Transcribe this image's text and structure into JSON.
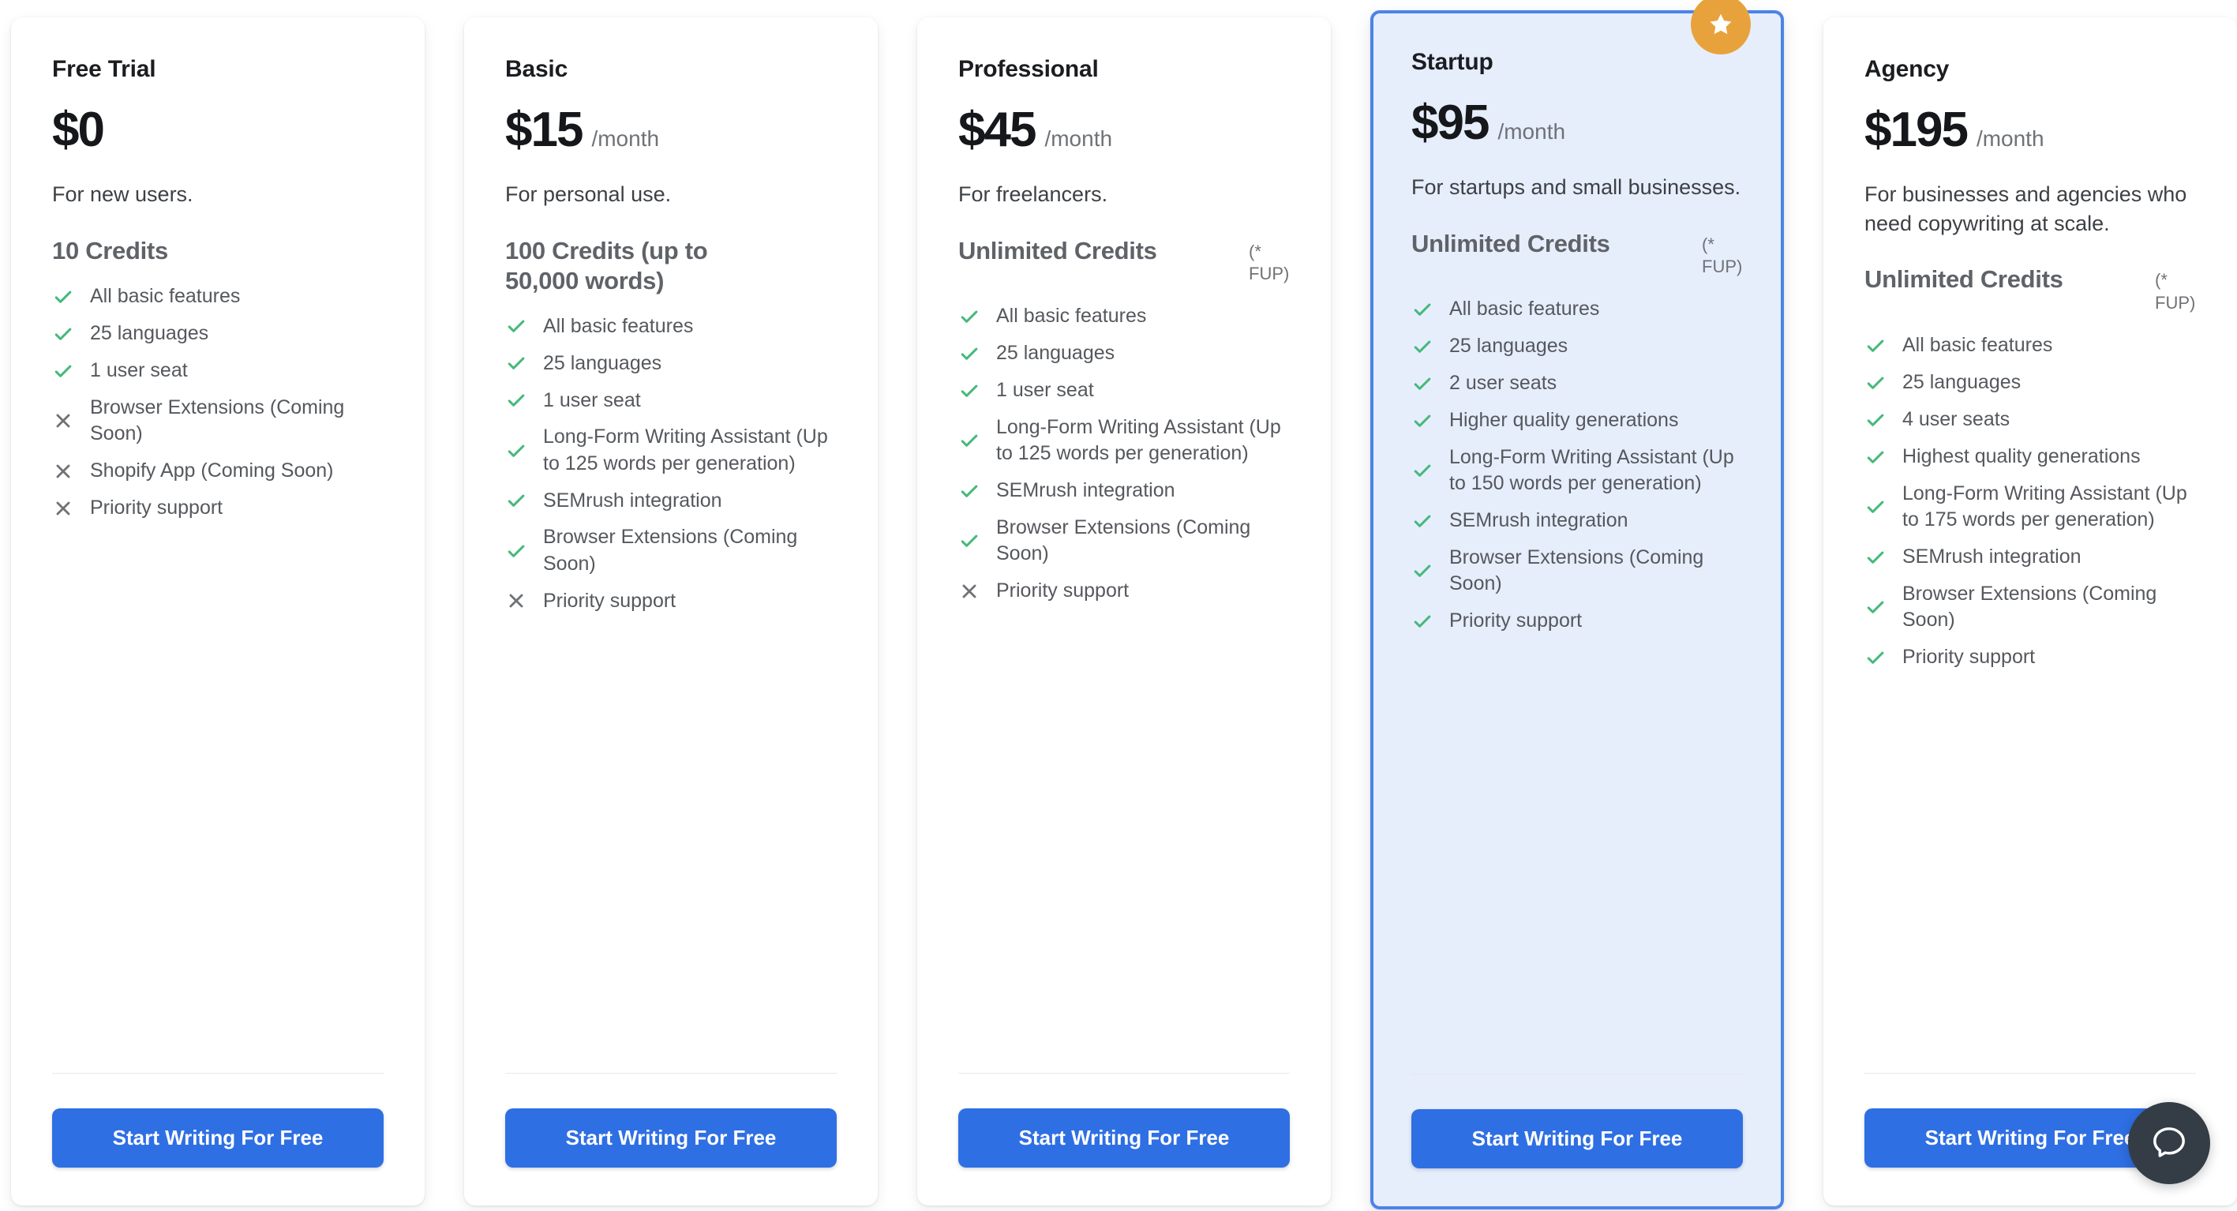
{
  "colors": {
    "cta_blue": "#2f6fe4",
    "featured_bg": "#e6eefc",
    "featured_border": "#4b83e8",
    "badge_orange": "#e8a23c",
    "check_green": "#46b97b",
    "cross_gray": "#6f7276",
    "chat_dark": "#343d46"
  },
  "cta_label": "Start Writing For Free",
  "credits_note": "(*\nFUP)",
  "featured_badge_icon": "star-icon",
  "chat_widget": {
    "icon": "chat-bubble-icon"
  },
  "plans": [
    {
      "name": "Free Trial",
      "price": "$0",
      "period": "",
      "tagline": "For new users.",
      "credits": "10 Credits",
      "credits_note": "",
      "featured": false,
      "cta": "Start Writing For Free",
      "features": [
        {
          "icon": "check-icon",
          "included": true,
          "text": "All basic features"
        },
        {
          "icon": "check-icon",
          "included": true,
          "text": "25 languages"
        },
        {
          "icon": "check-icon",
          "included": true,
          "text": "1 user seat"
        },
        {
          "icon": "cross-icon",
          "included": false,
          "text": "Browser Extensions (Coming Soon)"
        },
        {
          "icon": "cross-icon",
          "included": false,
          "text": "Shopify App (Coming Soon)"
        },
        {
          "icon": "cross-icon",
          "included": false,
          "text": "Priority support"
        }
      ]
    },
    {
      "name": "Basic",
      "price": "$15",
      "period": "/month",
      "tagline": "For personal use.",
      "credits": "100 Credits (up to 50,000 words)",
      "credits_note": "",
      "featured": false,
      "cta": "Start Writing For Free",
      "features": [
        {
          "icon": "check-icon",
          "included": true,
          "text": "All basic features"
        },
        {
          "icon": "check-icon",
          "included": true,
          "text": "25 languages"
        },
        {
          "icon": "check-icon",
          "included": true,
          "text": "1 user seat"
        },
        {
          "icon": "check-icon",
          "included": true,
          "text": "Long-Form Writing Assistant (Up to 125 words per generation)"
        },
        {
          "icon": "check-icon",
          "included": true,
          "text": "SEMrush integration"
        },
        {
          "icon": "check-icon",
          "included": true,
          "text": "Browser Extensions (Coming Soon)"
        },
        {
          "icon": "cross-icon",
          "included": false,
          "text": "Priority support"
        }
      ]
    },
    {
      "name": "Professional",
      "price": "$45",
      "period": "/month",
      "tagline": "For freelancers.",
      "credits": "Unlimited Credits",
      "credits_note": "(*\nFUP)",
      "featured": false,
      "cta": "Start Writing For Free",
      "features": [
        {
          "icon": "check-icon",
          "included": true,
          "text": "All basic features"
        },
        {
          "icon": "check-icon",
          "included": true,
          "text": "25 languages"
        },
        {
          "icon": "check-icon",
          "included": true,
          "text": "1 user seat"
        },
        {
          "icon": "check-icon",
          "included": true,
          "text": "Long-Form Writing Assistant (Up to 125 words per generation)"
        },
        {
          "icon": "check-icon",
          "included": true,
          "text": "SEMrush integration"
        },
        {
          "icon": "check-icon",
          "included": true,
          "text": "Browser Extensions (Coming Soon)"
        },
        {
          "icon": "cross-icon",
          "included": false,
          "text": "Priority support"
        }
      ]
    },
    {
      "name": "Startup",
      "price": "$95",
      "period": "/month",
      "tagline": "For startups and small businesses.",
      "credits": "Unlimited Credits",
      "credits_note": "(*\nFUP)",
      "featured": true,
      "cta": "Start Writing For Free",
      "features": [
        {
          "icon": "check-icon",
          "included": true,
          "text": "All basic features"
        },
        {
          "icon": "check-icon",
          "included": true,
          "text": "25 languages"
        },
        {
          "icon": "check-icon",
          "included": true,
          "text": "2 user seats"
        },
        {
          "icon": "check-icon",
          "included": true,
          "text": "Higher quality generations"
        },
        {
          "icon": "check-icon",
          "included": true,
          "text": "Long-Form Writing Assistant (Up to 150 words per generation)"
        },
        {
          "icon": "check-icon",
          "included": true,
          "text": "SEMrush integration"
        },
        {
          "icon": "check-icon",
          "included": true,
          "text": "Browser Extensions (Coming Soon)"
        },
        {
          "icon": "check-icon",
          "included": true,
          "text": "Priority support"
        }
      ]
    },
    {
      "name": "Agency",
      "price": "$195",
      "period": "/month",
      "tagline": "For businesses and agencies who need copywriting at scale.",
      "credits": "Unlimited Credits",
      "credits_note": "(*\nFUP)",
      "featured": false,
      "cta": "Start Writing For Free",
      "features": [
        {
          "icon": "check-icon",
          "included": true,
          "text": "All basic features"
        },
        {
          "icon": "check-icon",
          "included": true,
          "text": "25 languages"
        },
        {
          "icon": "check-icon",
          "included": true,
          "text": "4 user seats"
        },
        {
          "icon": "check-icon",
          "included": true,
          "text": "Highest quality generations"
        },
        {
          "icon": "check-icon",
          "included": true,
          "text": "Long-Form Writing Assistant (Up to 175 words per generation)"
        },
        {
          "icon": "check-icon",
          "included": true,
          "text": "SEMrush integration"
        },
        {
          "icon": "check-icon",
          "included": true,
          "text": "Browser Extensions (Coming Soon)"
        },
        {
          "icon": "check-icon",
          "included": true,
          "text": "Priority support"
        }
      ]
    }
  ]
}
